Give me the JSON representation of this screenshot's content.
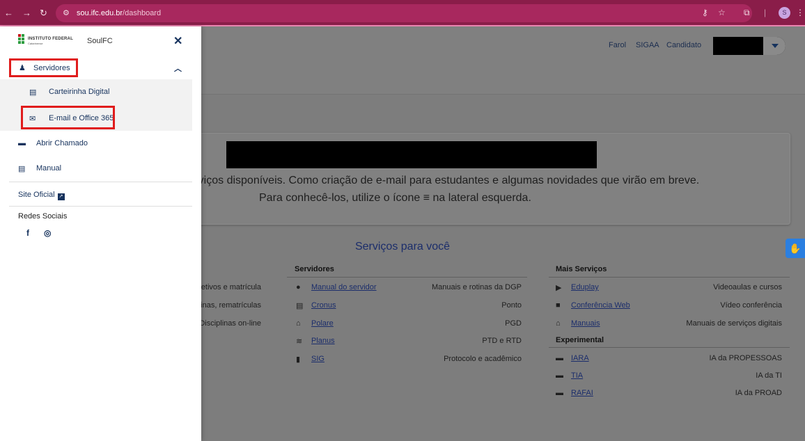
{
  "browser": {
    "url_host": "sou.ifc.edu.br",
    "url_path": "/dashboard",
    "profile_initial": "S",
    "accent_color": "#8a1d49"
  },
  "topnav": {
    "links": [
      "Farol",
      "SIGAA",
      "Candidato"
    ]
  },
  "welcome": {
    "line1": "s serviços disponíveis. Como criação de e-mail para estudantes e algumas novidades que virão em breve.",
    "line2": "Para conhecê-los, utilize o ícone ≡ na lateral esquerda."
  },
  "services": {
    "title": "Serviços para você",
    "partial_left": [
      "eletivos e matrícula",
      "plinas, rematrículas",
      "Disciplinas on-line"
    ],
    "servidores": {
      "heading": "Servidores",
      "items": [
        {
          "icon": "user-circle-icon",
          "link": "Manual do servidor",
          "desc": "Manuais e rotinas da DGP"
        },
        {
          "icon": "id-card-icon",
          "link": "Cronus",
          "desc": "Ponto"
        },
        {
          "icon": "house-user-icon",
          "link": "Polare",
          "desc": "PGD"
        },
        {
          "icon": "layers-icon",
          "link": "Planus",
          "desc": "PTD e RTD"
        },
        {
          "icon": "file-icon",
          "link": "SIG",
          "desc": "Protocolo e acadêmico"
        }
      ]
    },
    "mais": {
      "heading": "Mais Serviços",
      "items": [
        {
          "icon": "play-icon",
          "link": "Eduplay",
          "desc": "Videoaulas e cursos"
        },
        {
          "icon": "video-icon",
          "link": "Conferência Web",
          "desc": "Vídeo conferência"
        },
        {
          "icon": "house-user-icon",
          "link": "Manuais",
          "desc": "Manuais de serviços digitais"
        }
      ]
    },
    "experimental": {
      "heading": "Experimental",
      "items": [
        {
          "icon": "chat-icon",
          "link": "IARA",
          "desc": "IA da PROPESSOAS"
        },
        {
          "icon": "chat-icon",
          "link": "TIA",
          "desc": "IA da TI"
        },
        {
          "icon": "chat-icon",
          "link": "RAFAI",
          "desc": "IA da PROAD"
        }
      ]
    }
  },
  "drawer": {
    "logo_name": "INSTITUTO FEDERAL",
    "logo_sub": "Catarinense",
    "app_name": "SoulFC",
    "section_label": "Servidores",
    "sub_items": [
      "Carteirinha Digital",
      "E-mail e Office 365"
    ],
    "items": [
      "Abrir Chamado",
      "Manual"
    ],
    "site_official": "Site Oficial",
    "social_title": "Redes Sociais",
    "highlight_color": "#e01c1c"
  }
}
